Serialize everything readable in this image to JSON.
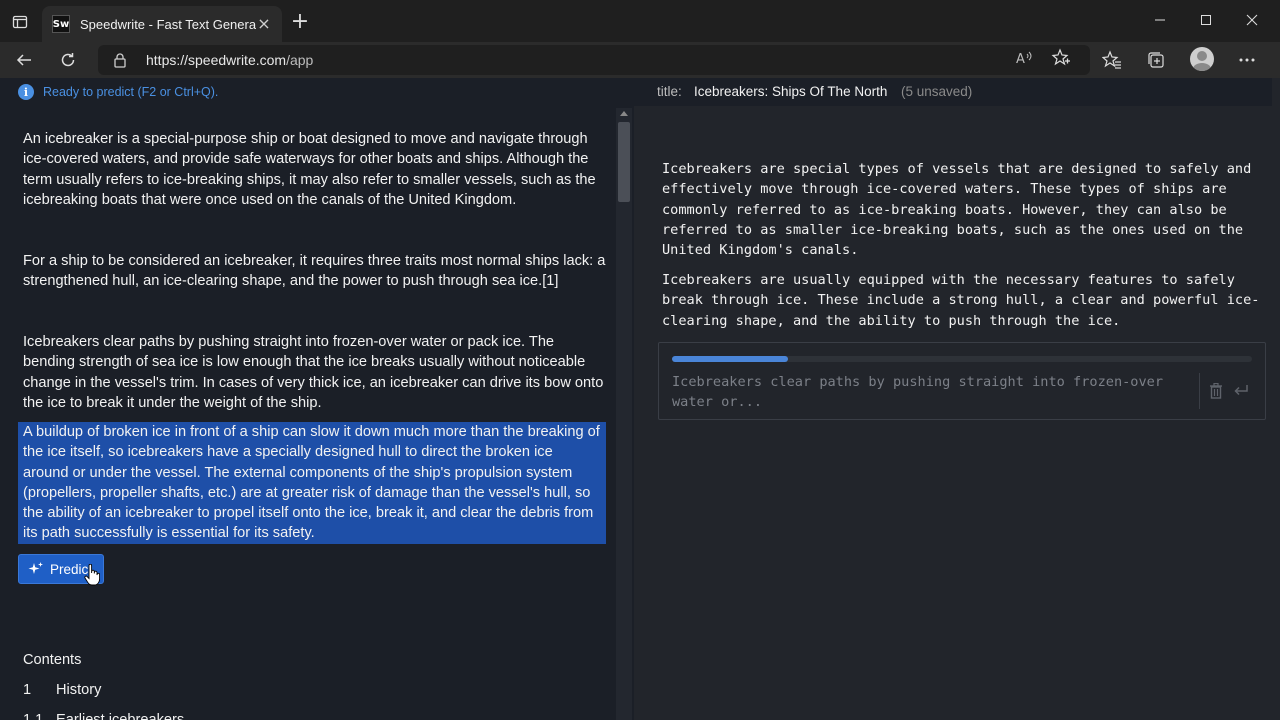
{
  "browser": {
    "tab_title": "Speedwrite - Fast Text Generator",
    "favicon_text": "Sw",
    "url_host": "https://speedwrite.com",
    "url_path": "/app"
  },
  "status": {
    "text": "Ready to predict (F2 or Ctrl+Q)."
  },
  "document": {
    "paragraphs": [
      "An icebreaker is a special-purpose ship or boat designed to move and navigate through ice-covered waters, and provide safe waterways for other boats and ships. Although the term usually refers to ice-breaking ships, it may also refer to smaller vessels, such as the icebreaking boats that were once used on the canals of the United Kingdom.",
      "For a ship to be considered an icebreaker, it requires three traits most normal ships lack: a strengthened hull, an ice-clearing shape, and the power to push through sea ice.[1]",
      "Icebreakers clear paths by pushing straight into frozen-over water or pack ice.  The bending strength of sea ice is low enough that the ice breaks usually without noticeable change in the vessel's trim.  In cases of very thick ice, an icebreaker can drive its bow onto the ice to break it under the weight of the ship.",
      "A buildup of broken ice in front of a ship can slow it down much more than the breaking of the ice itself, so icebreakers have a specially designed hull to direct the broken ice around or under the vessel.  The external components of the ship's propulsion system (propellers, propeller shafts, etc.) are at greater risk of damage than the vessel's hull, so the ability of an icebreaker to propel itself onto the ice, break it, and clear the debris from its path successfully is essential for its safety."
    ],
    "predict_label": "Predict",
    "contents_heading": "Contents",
    "toc": [
      {
        "num": "1",
        "label": "History"
      },
      {
        "num": "1.1",
        "label": "Earliest icebreakers"
      }
    ]
  },
  "output": {
    "title_label": "title:",
    "title_value": "Icebreakers: Ships Of The North",
    "unsaved": "(5 unsaved)",
    "paragraphs": [
      "Icebreakers are special types of vessels that are designed to safely and effectively move through ice-covered waters. These types of ships are commonly referred to as ice-breaking boats. However, they can also be referred to as smaller ice-breaking boats, such as the ones used on the United Kingdom's canals.",
      "Icebreakers are usually equipped with the necessary features to safely break through ice. These include a strong hull, a clear and powerful ice-clearing shape, and the ability to push through the ice."
    ],
    "prediction_text": "Icebreakers clear paths by pushing straight into frozen-over water or...",
    "progress": 0.2
  },
  "colors": {
    "accent": "#1f5fc6",
    "selection": "#1e4fa8",
    "status_blue": "#4a90e2"
  }
}
